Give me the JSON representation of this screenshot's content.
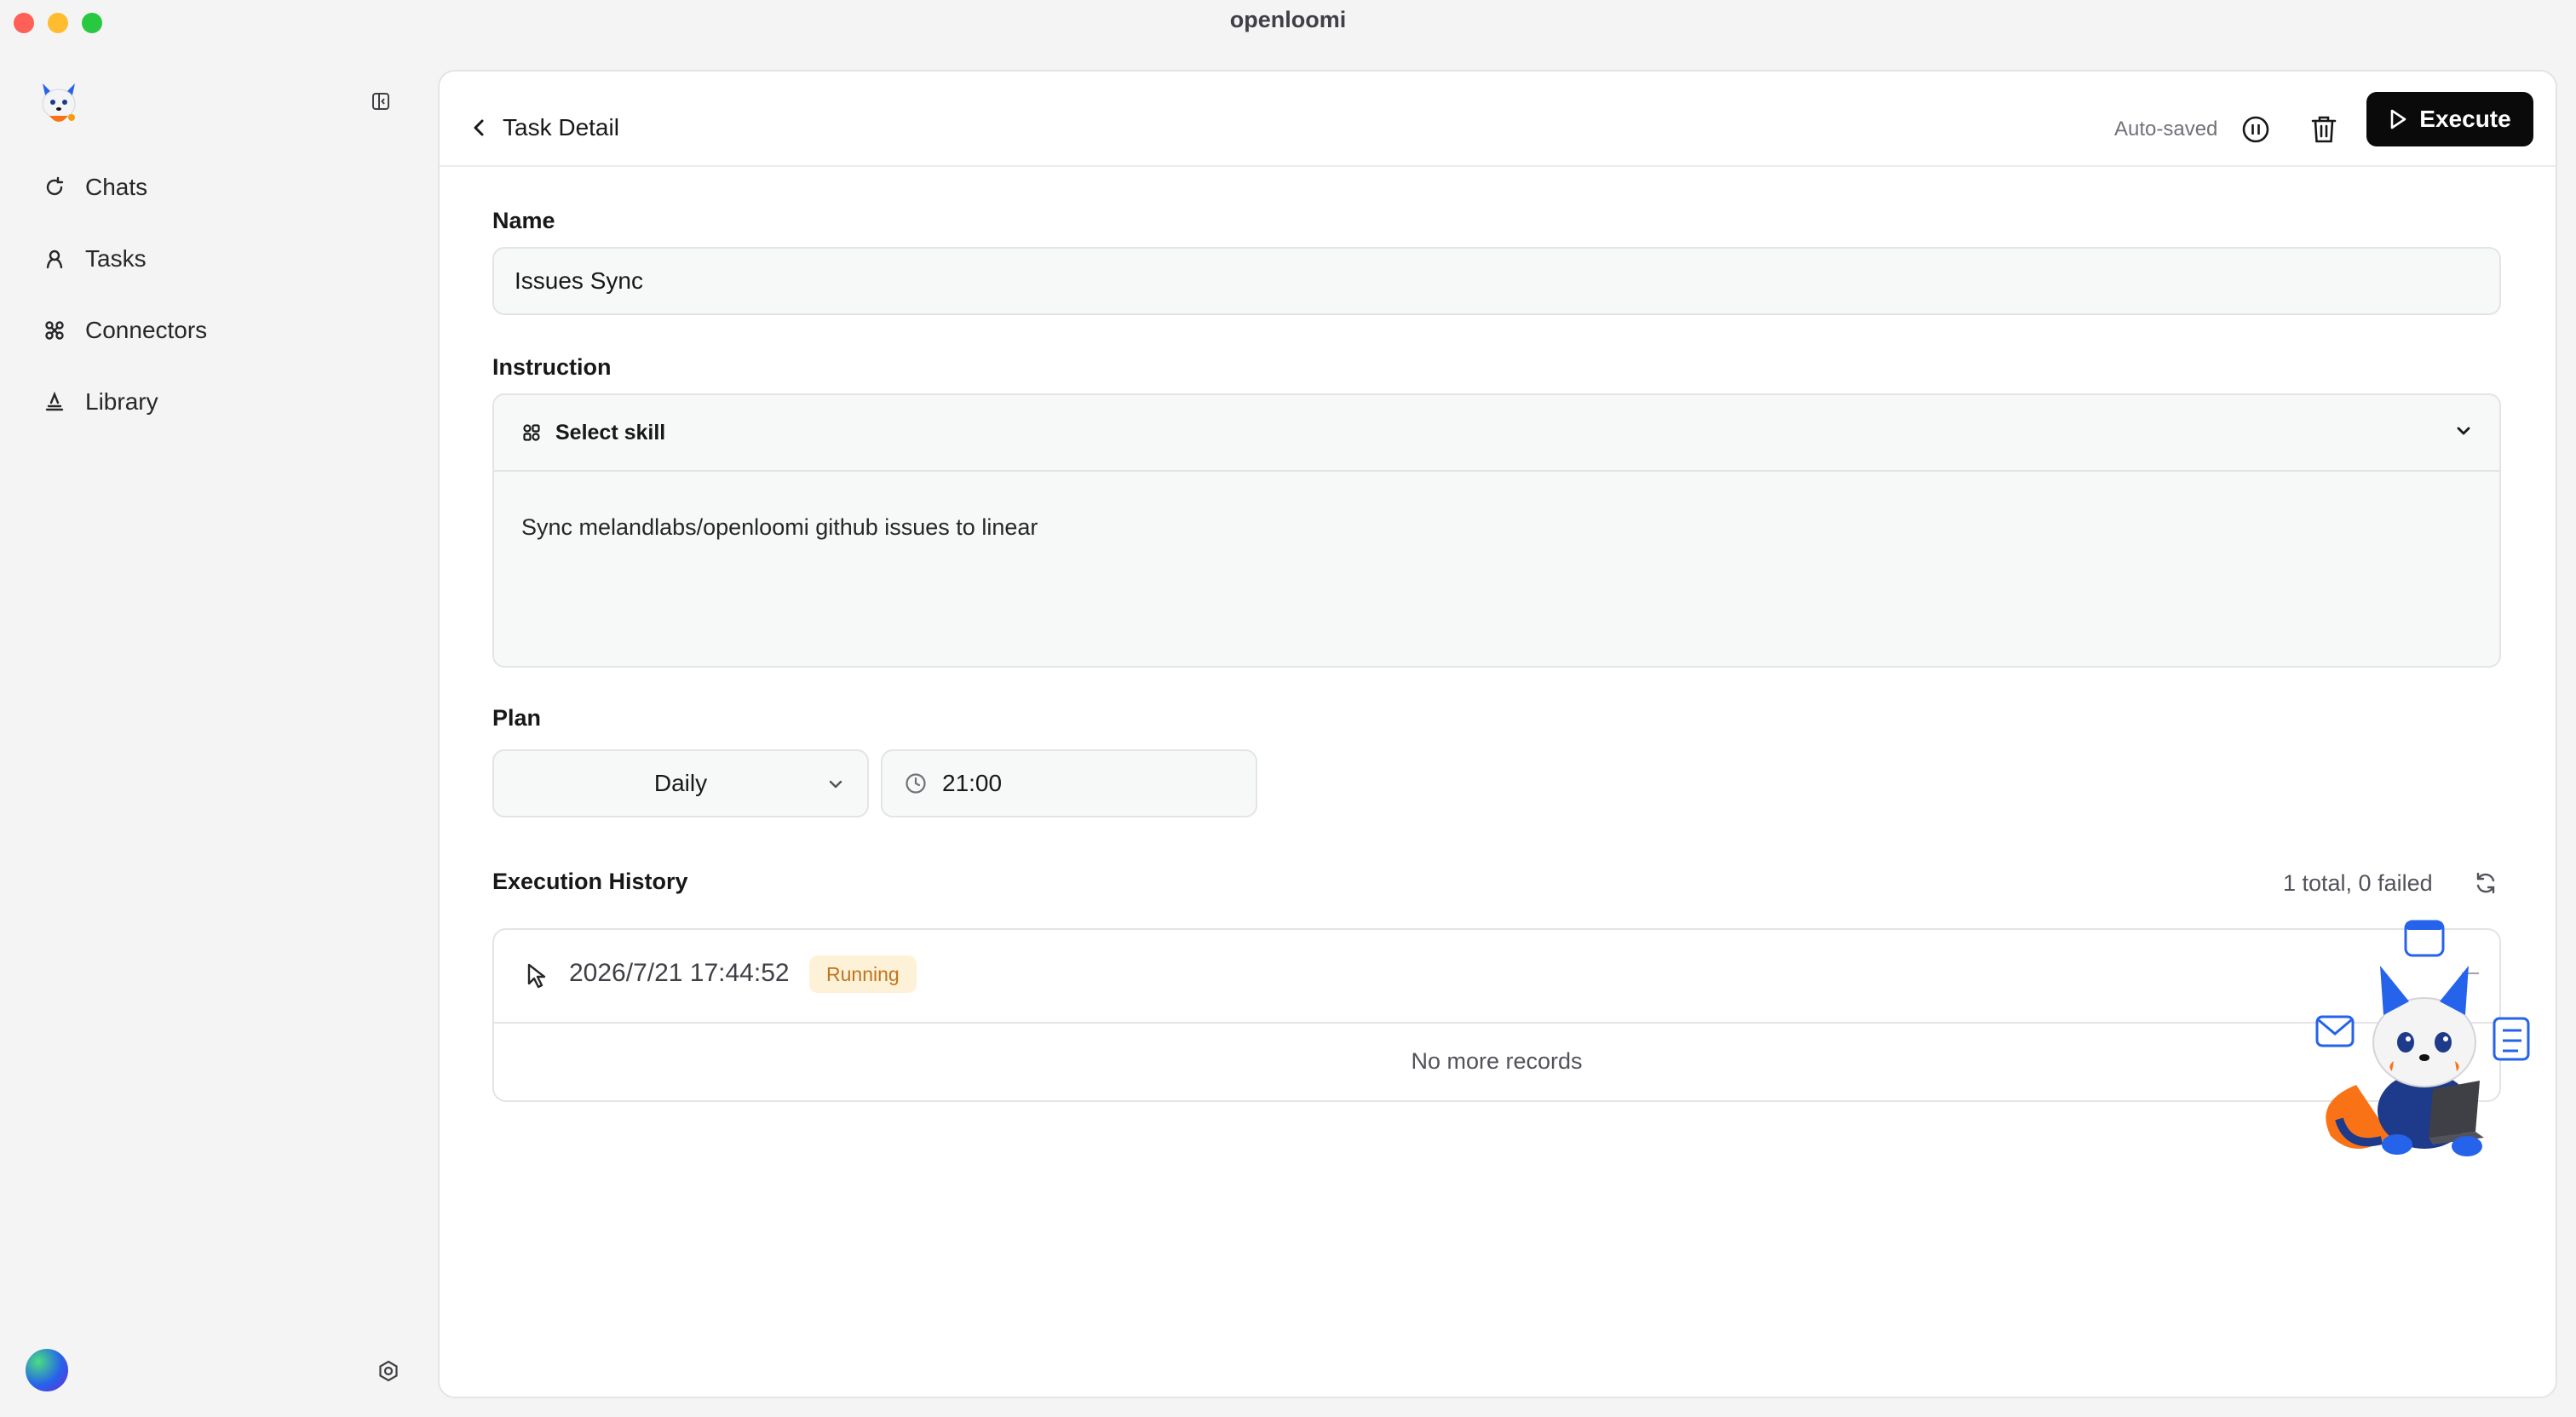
{
  "window": {
    "title": "openloomi"
  },
  "sidebar": {
    "items": [
      {
        "label": "Chats",
        "icon": "chat-refresh-icon"
      },
      {
        "label": "Tasks",
        "icon": "tasks-icon"
      },
      {
        "label": "Connectors",
        "icon": "connectors-icon"
      },
      {
        "label": "Library",
        "icon": "library-icon"
      }
    ]
  },
  "header": {
    "back_label": "Task Detail",
    "autosaved": "Auto-saved",
    "execute_label": "Execute"
  },
  "form": {
    "name_label": "Name",
    "name_value": "Issues Sync",
    "instruction_label": "Instruction",
    "select_skill": "Select skill",
    "instruction_text": "Sync melandlabs/openloomi github issues to linear",
    "plan_label": "Plan",
    "plan_frequency": "Daily",
    "plan_time": "21:00"
  },
  "history": {
    "title": "Execution History",
    "stats": "1 total, 0 failed",
    "records": [
      {
        "timestamp": "2026/7/21 17:44:52",
        "status": "Running"
      }
    ],
    "footer": "No more records"
  },
  "colors": {
    "accent": "#0a0a0a",
    "status_running_bg": "#fdf1d8",
    "status_running_fg": "#c2731b"
  }
}
